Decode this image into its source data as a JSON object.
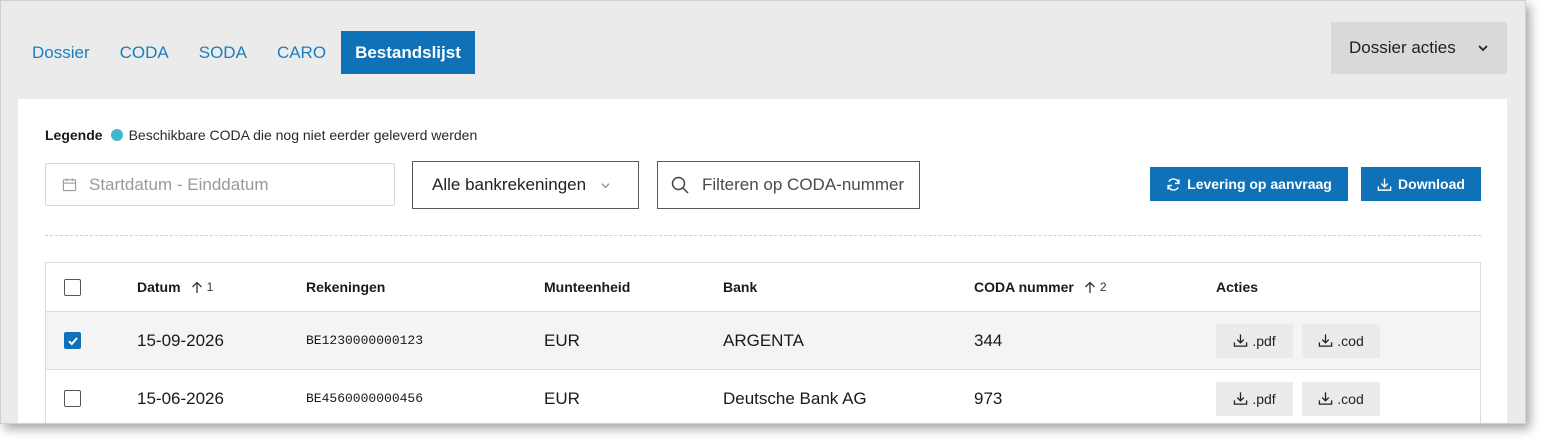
{
  "tabs": [
    {
      "label": "Dossier",
      "active": false
    },
    {
      "label": "CODA",
      "active": false
    },
    {
      "label": "SODA",
      "active": false
    },
    {
      "label": "CARO",
      "active": false
    },
    {
      "label": "Bestandslijst",
      "active": true
    }
  ],
  "dossier_actions_label": "Dossier acties",
  "legend": {
    "title": "Legende",
    "dot_color": "#3eb8cc",
    "text": "Beschikbare CODA die nog niet eerder geleverd werden"
  },
  "filters": {
    "date_placeholder": "Startdatum - Einddatum",
    "account_select_value": "Alle bankrekeningen",
    "search_placeholder": "Filteren op CODA-nummer"
  },
  "buttons": {
    "levering_label": "Levering op aanvraag",
    "download_label": "Download"
  },
  "table": {
    "columns": {
      "date": "Datum",
      "date_sort_order": "1",
      "accounts": "Rekeningen",
      "currency": "Munteenheid",
      "bank": "Bank",
      "coda_number": "CODA nummer",
      "coda_sort_order": "2",
      "actions": "Acties"
    },
    "rows": [
      {
        "checked": true,
        "date": "15-09-2026",
        "account": "BE1230000000123",
        "currency": "EUR",
        "bank": "ARGENTA",
        "coda_number": "344",
        "pdf_label": ".pdf",
        "cod_label": ".cod"
      },
      {
        "checked": false,
        "date": "15-06-2026",
        "account": "BE4560000000456",
        "currency": "EUR",
        "bank": "Deutsche Bank AG",
        "coda_number": "973",
        "pdf_label": ".pdf",
        "cod_label": ".cod"
      }
    ]
  },
  "colors": {
    "primary": "#0f72b8",
    "tab_link": "#1a7fc1"
  }
}
